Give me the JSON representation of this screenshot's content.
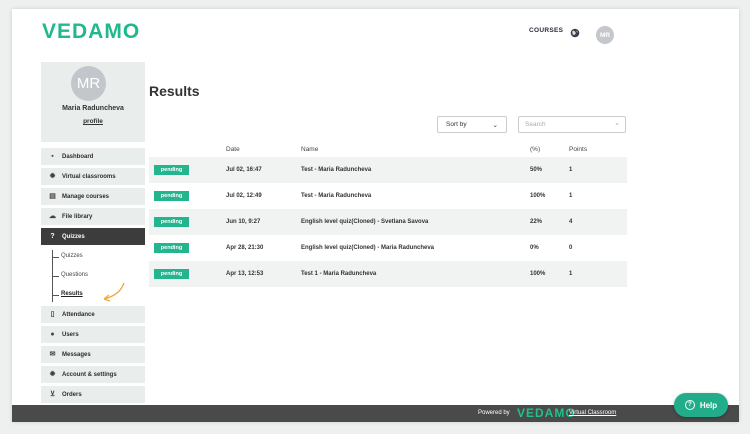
{
  "brand": {
    "logo": "VEDAMO",
    "accent": "#20b88c"
  },
  "topbar": {
    "courses": "COURSES",
    "avatar_initials": "MR",
    "globe_icon": "globe-icon"
  },
  "profile": {
    "initials": "MR",
    "name": "Maria Raduncheva",
    "link": "profile"
  },
  "sidebar": {
    "items_top": [
      {
        "label": "Dashboard",
        "icon": "grid-icon"
      },
      {
        "label": "Virtual classrooms",
        "icon": "gear-icon"
      },
      {
        "label": "Manage courses",
        "icon": "book-icon"
      },
      {
        "label": "File library",
        "icon": "cloud-icon"
      },
      {
        "label": "Quizzes",
        "icon": "question-icon"
      }
    ],
    "quiz_sub": [
      "Quizzes",
      "Questions",
      "Results"
    ],
    "items_bottom": [
      {
        "label": "Attendance",
        "icon": "document-icon"
      },
      {
        "label": "Users",
        "icon": "users-icon"
      },
      {
        "label": "Messages",
        "icon": "envelope-icon"
      },
      {
        "label": "Account & settings",
        "icon": "gear-icon"
      },
      {
        "label": "Orders",
        "icon": "cart-icon"
      }
    ]
  },
  "main": {
    "title": "Results",
    "sort_label": "Sort by",
    "search_placeholder": "Search",
    "columns": {
      "date": "Date",
      "name": "Name",
      "percent": "(%)",
      "points": "Points"
    },
    "rows": [
      {
        "status": "pending",
        "date": "Jul 02, 16:47",
        "name": "Test - Maria Raduncheva",
        "percent": "50%",
        "points": "1"
      },
      {
        "status": "pending",
        "date": "Jul 02, 12:49",
        "name": "Test - Maria Raduncheva",
        "percent": "100%",
        "points": "1"
      },
      {
        "status": "pending",
        "date": "Jun 10, 9:27",
        "name": "English level quiz(Cloned) - Svetlana Savova",
        "percent": "22%",
        "points": "4"
      },
      {
        "status": "pending",
        "date": "Apr 28, 21:30",
        "name": "English level quiz(Cloned) - Maria Raduncheva",
        "percent": "0%",
        "points": "0"
      },
      {
        "status": "pending",
        "date": "Apr 13, 12:53",
        "name": "Test 1 - Maria Raduncheva",
        "percent": "100%",
        "points": "1"
      }
    ]
  },
  "footer": {
    "powered": "Powered by",
    "logo": "VEDAMO",
    "link": "Virtual Classroom"
  },
  "help": {
    "label": "Help"
  }
}
